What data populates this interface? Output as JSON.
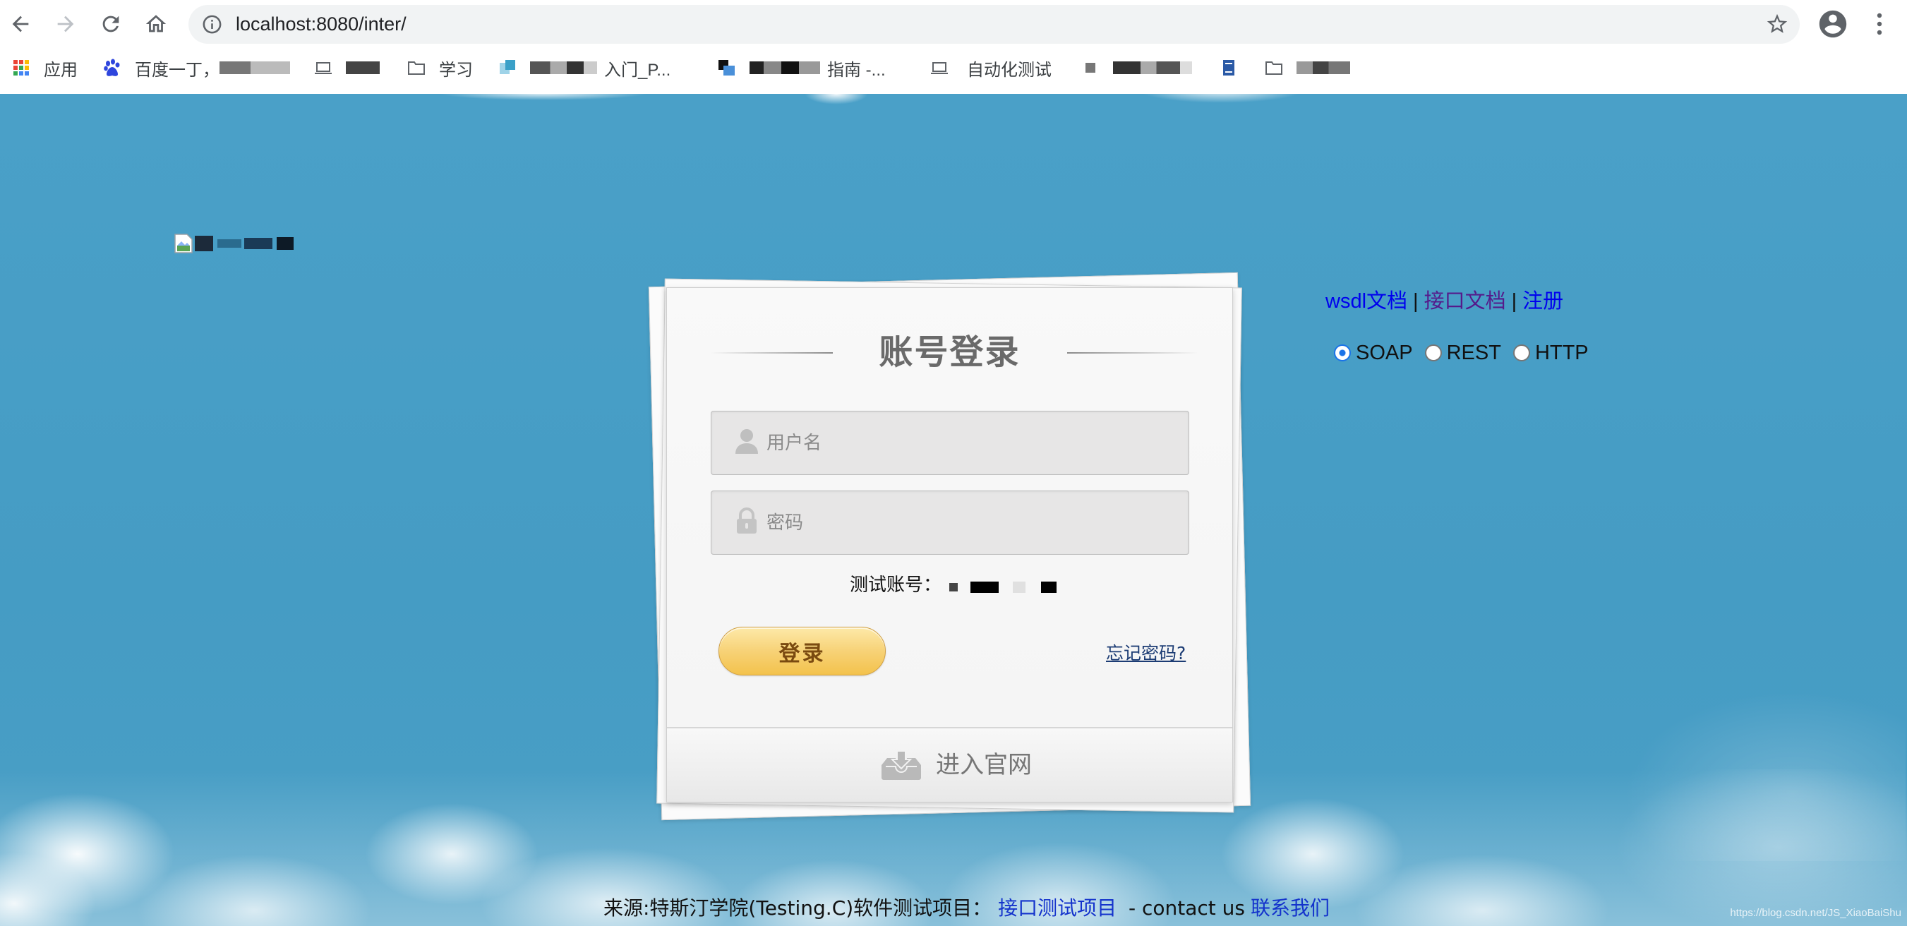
{
  "browser": {
    "url": "localhost:8080/inter/",
    "bookmarks": [
      {
        "label": "应用",
        "icon": "apps-grid-icon"
      },
      {
        "label": "百度一丁，",
        "icon": "baidu-paw-icon"
      },
      {
        "icon": "laptop-icon"
      },
      {
        "label": "学习",
        "icon": "folder-icon"
      },
      {
        "label": "入门_P...",
        "icon": "site-favicon"
      },
      {
        "label": "指南 -...",
        "icon": "site-favicon"
      },
      {
        "label": "自动化测试",
        "icon": "laptop-icon"
      },
      {
        "icon": "page-icon"
      },
      {
        "icon": "book-icon"
      },
      {
        "icon": "folder-icon"
      }
    ]
  },
  "page": {
    "login": {
      "title": "账号登录",
      "username_placeholder": "用户名",
      "password_placeholder": "密码",
      "test_account_label": "测试账号：",
      "login_button": "登录",
      "forgot_password": "忘记密码?",
      "enter_site": "进入官网"
    },
    "links": {
      "wsdl": "wsdl文档",
      "separator": "|",
      "api_docs": "接口文档",
      "register": "注册"
    },
    "protocols": {
      "options": [
        "SOAP",
        "REST",
        "HTTP"
      ],
      "selected": "SOAP"
    },
    "footer": {
      "source": "来源:特斯汀学院(Testing.C)软件测试项目：",
      "project_link": "接口测试项目",
      "contact_text": "- contact us",
      "contact_link": "联系我们"
    },
    "watermark": "https://blog.csdn.net/JS_XiaoBaiShu"
  },
  "colors": {
    "page_background": "#469dc5",
    "link": "#0000ee",
    "visited_link": "#551a8b",
    "login_button": "#f5c95a",
    "radio_checked": "#1a73e8"
  }
}
